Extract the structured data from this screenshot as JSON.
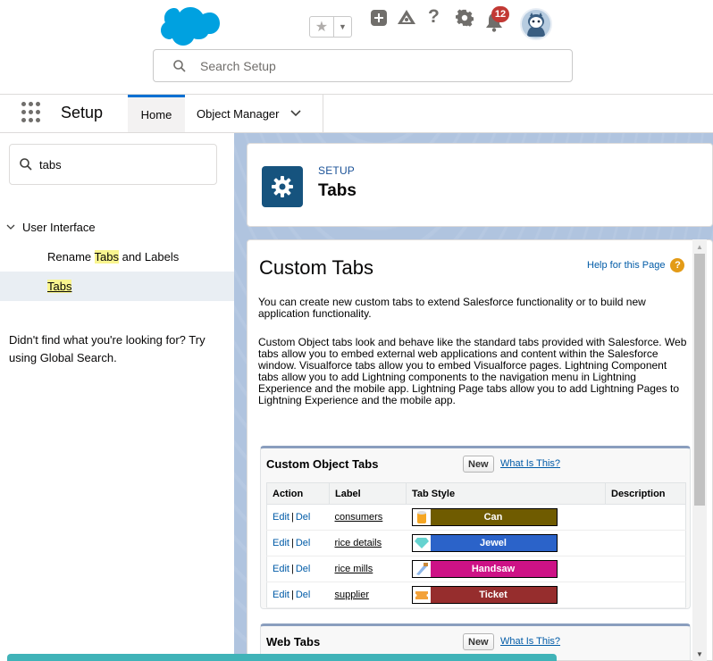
{
  "header": {
    "search_placeholder": "Search Setup",
    "notification_count": "12",
    "icons": [
      "salesforce-cloud-logo",
      "star-icon",
      "chevron-down-icon",
      "add-icon",
      "trailhead-icon",
      "help-icon",
      "gear-icon",
      "bell-icon",
      "avatar"
    ]
  },
  "nav": {
    "app_name": "Setup",
    "tabs": [
      {
        "label": "Home",
        "active": true
      },
      {
        "label": "Object Manager",
        "has_dropdown": true
      }
    ]
  },
  "sidebar": {
    "quick_find_value": "tabs",
    "section": "User Interface",
    "items": [
      {
        "before": "Rename ",
        "highlight": "Tabs",
        "after": " and Labels"
      },
      {
        "before": "",
        "highlight": "Tabs",
        "after": "",
        "selected": true
      }
    ],
    "not_found_text": "Didn't find what you're looking for? Try using Global Search."
  },
  "page_header": {
    "eyebrow": "SETUP",
    "title": "Tabs"
  },
  "content": {
    "title": "Custom Tabs",
    "help_link": "Help for this Page",
    "para1": "You can create new custom tabs to extend Salesforce functionality or to build new application functionality.",
    "para2": "Custom Object tabs look and behave like the standard tabs provided with Salesforce. Web tabs allow you to embed external web applications and content within the Salesforce window. Visualforce tabs allow you to embed Visualforce pages. Lightning Component tabs allow you to add Lightning components to the navigation menu in Lightning Experience and the mobile app. Lightning Page tabs allow you to add Lightning Pages to Lightning Experience and the mobile app."
  },
  "custom_object_tabs": {
    "title": "Custom Object Tabs",
    "new_label": "New",
    "what_is_this": "What Is This?",
    "columns": [
      "Action",
      "Label",
      "Tab Style",
      "Description"
    ],
    "edit_label": "Edit",
    "separator": "|",
    "del_label": "Del",
    "rows": [
      {
        "label": "consumers",
        "style": "Can",
        "color": "#6f5b00",
        "icon": "can-icon"
      },
      {
        "label": "rice details",
        "style": "Jewel",
        "color": "#2b63c9",
        "icon": "jewel-icon"
      },
      {
        "label": "rice mills",
        "style": "Handsaw",
        "color": "#cd1286",
        "icon": "handsaw-icon"
      },
      {
        "label": "supplier",
        "style": "Ticket",
        "color": "#962d2d",
        "icon": "ticket-icon"
      }
    ]
  },
  "web_tabs": {
    "title": "Web Tabs",
    "new_label": "New",
    "what_is_this": "What Is This?"
  }
}
